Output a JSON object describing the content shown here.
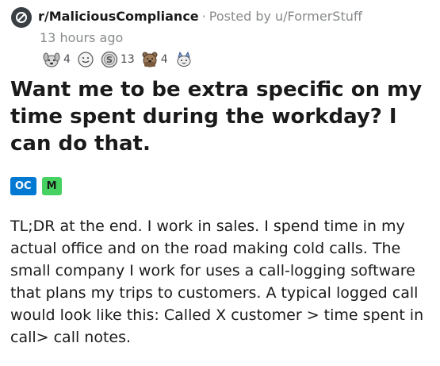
{
  "post": {
    "subreddit": "r/MaliciousCompliance",
    "separator": "·",
    "posted_by": "Posted by u/FormerStuff",
    "time_ago": "13 hours ago",
    "awards": [
      {
        "icon": "dog-award-icon",
        "count": "4"
      },
      {
        "icon": "smiley-award-icon",
        "count": ""
      },
      {
        "icon": "silver-award-icon",
        "count": "13"
      },
      {
        "icon": "bear-award-icon",
        "count": "4"
      },
      {
        "icon": "cat-award-icon",
        "count": ""
      }
    ],
    "title": "Want me to be extra specific on my time spent during the workday? I can do that.",
    "flairs": {
      "oc": "OC",
      "m": "M"
    },
    "body": "TL;DR at the end. I work in sales. I spend time in my actual office and on the road making cold calls. The small company I work for uses a call-logging software that plans my trips to customers. A typical logged call would look like this: Called X customer > time spent in call> call notes."
  },
  "colors": {
    "flair_oc": "#0079d3",
    "flair_m": "#46d160",
    "meta_gray": "#878a8c",
    "subreddit_icon_bg": "#3a3f44"
  }
}
